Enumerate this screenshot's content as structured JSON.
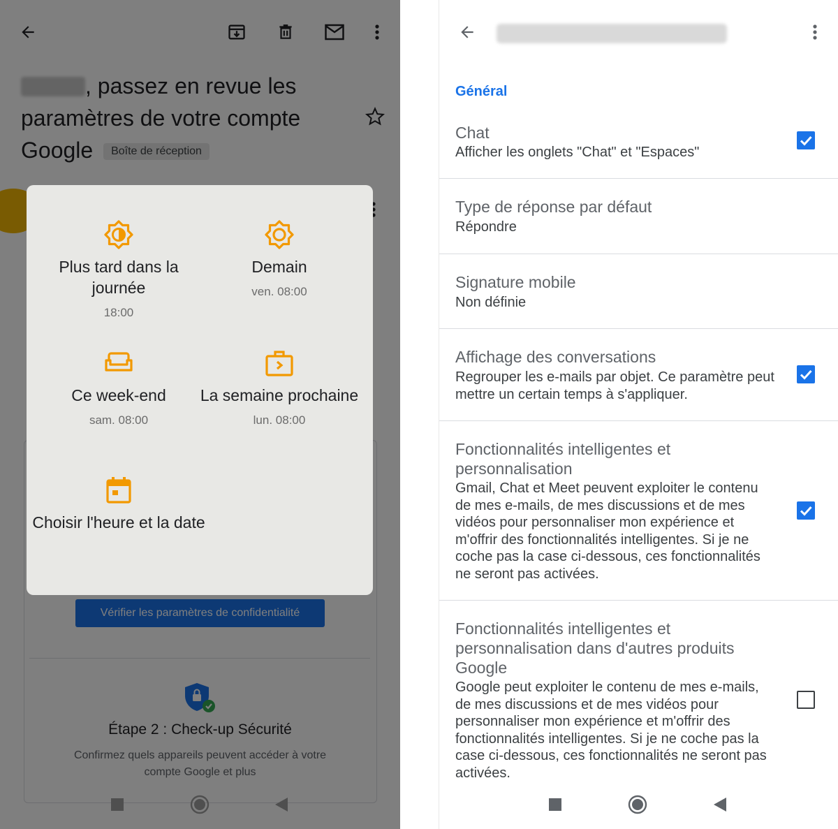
{
  "left": {
    "subject_text": ", passez en revue les paramètres de votre compte Google",
    "label": "Boîte de réception",
    "privacy_button": "Vérifier les paramètres de confidentialité",
    "step2_title": "Étape 2 : Check-up Sécurité",
    "step2_desc": "Confirmez quels appareils peuvent accéder à votre compte Google et plus",
    "snooze": {
      "options": [
        {
          "label": "Plus tard dans la journée",
          "time": "18:00",
          "icon": "brightness-medium-icon"
        },
        {
          "label": "Demain",
          "time": "ven. 08:00",
          "icon": "sun-icon"
        },
        {
          "label": "Ce week-end",
          "time": "sam. 08:00",
          "icon": "sofa-icon"
        },
        {
          "label": "La semaine prochaine",
          "time": "lun. 08:00",
          "icon": "briefcase-icon"
        },
        {
          "label": "Choisir l'heure et la date",
          "icon": "calendar-icon"
        }
      ]
    }
  },
  "right": {
    "section_title": "Général",
    "settings": [
      {
        "title": "Chat",
        "desc": "Afficher les onglets \"Chat\" et \"Espaces\"",
        "checked": true
      },
      {
        "title": "Type de réponse par défaut",
        "desc": "Répondre"
      },
      {
        "title": "Signature mobile",
        "desc": "Non définie"
      },
      {
        "title": "Affichage des conversations",
        "desc": "Regrouper les e-mails par objet. Ce paramètre peut mettre un certain temps à s'appliquer.",
        "checked": true
      },
      {
        "title": "Fonctionnalités intelligentes et personnalisation",
        "desc": "Gmail, Chat et Meet peuvent exploiter le contenu de mes e-mails, de mes discussions et de mes vidéos pour personnaliser mon expérience et m'offrir des fonctionnalités intelligentes. Si je ne coche pas la case ci-dessous, ces fonctionnalités ne seront pas activées.",
        "checked": true
      },
      {
        "title": "Fonctionnalités intelligentes et personnalisation dans d'autres produits Google",
        "desc": "Google peut exploiter le contenu de mes e-mails, de mes discussions et de mes vidéos pour personnaliser mon expérience et m'offrir des fonctionnalités intelligentes. Si je ne coche pas la case ci-dessous, ces fonctionnalités ne seront pas activées.",
        "checked": false
      }
    ]
  },
  "colors": {
    "accent": "#1a73e8",
    "snooze_orange": "#f29900",
    "avatar": "#f2b704"
  }
}
